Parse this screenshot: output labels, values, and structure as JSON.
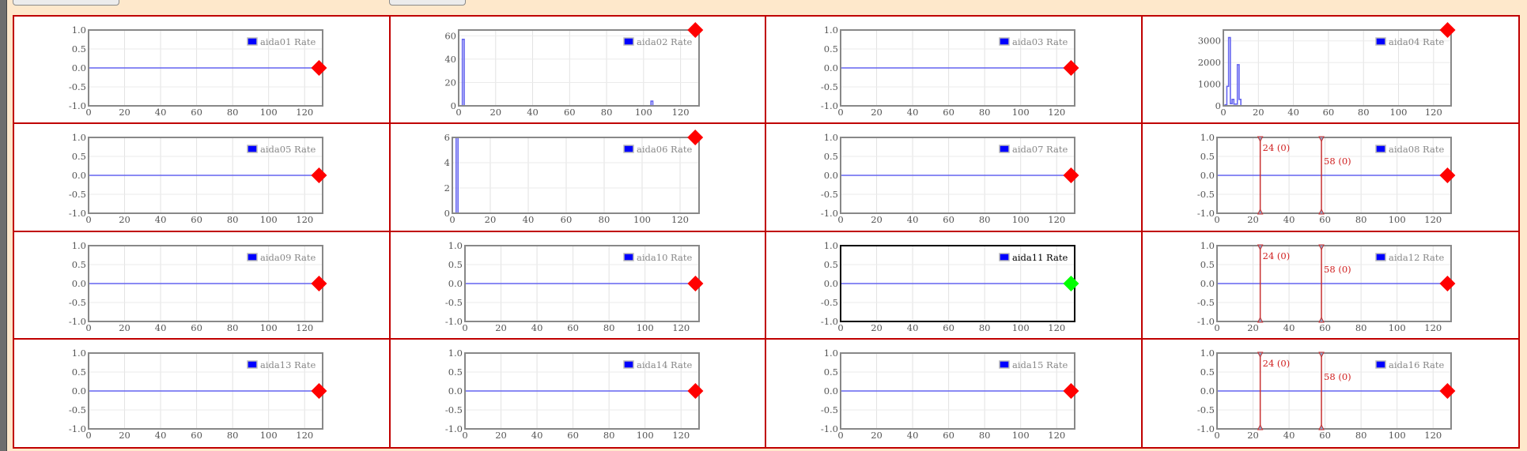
{
  "colors": {
    "accent": "#c00000",
    "series": "#6464f0",
    "marker_alarm": "#ff0000",
    "marker_ok": "#00ff00",
    "cursor": "#d02020"
  },
  "charts": [
    {
      "legend": "aida01 Rate",
      "ylim": [
        -1,
        1
      ],
      "yticks": [
        "1.0",
        "0.5",
        "0.0",
        "-0.5",
        "-1.0"
      ],
      "ytick_values": [
        1,
        0.5,
        0,
        -0.5,
        -1
      ],
      "points": [
        [
          0,
          0
        ],
        [
          128,
          0
        ]
      ],
      "marker": {
        "x": 128,
        "y": 0,
        "color": "#ff0000"
      }
    },
    {
      "legend": "aida02 Rate",
      "ylim": [
        0,
        65
      ],
      "yticks": [
        "60",
        "40",
        "20",
        "0"
      ],
      "ytick_values": [
        60,
        40,
        20,
        0
      ],
      "points": [
        [
          0,
          0
        ],
        [
          2,
          0
        ],
        [
          2,
          57
        ],
        [
          3,
          57
        ],
        [
          3,
          0
        ],
        [
          104,
          0
        ],
        [
          104,
          4
        ],
        [
          105,
          4
        ],
        [
          105,
          0
        ],
        [
          128,
          0
        ]
      ],
      "marker": {
        "x": 128,
        "y": 65,
        "color": "#ff0000"
      }
    },
    {
      "legend": "aida03 Rate",
      "ylim": [
        -1,
        1
      ],
      "yticks": [
        "1.0",
        "0.5",
        "0.0",
        "-0.5",
        "-1.0"
      ],
      "ytick_values": [
        1,
        0.5,
        0,
        -0.5,
        -1
      ],
      "points": [
        [
          0,
          0
        ],
        [
          128,
          0
        ]
      ],
      "marker": {
        "x": 128,
        "y": 0,
        "color": "#ff0000"
      }
    },
    {
      "legend": "aida04 Rate",
      "ylim": [
        0,
        3500
      ],
      "yticks": [
        "3000",
        "2000",
        "1000",
        "0"
      ],
      "ytick_values": [
        3000,
        2000,
        1000,
        0
      ],
      "points": [
        [
          0,
          0
        ],
        [
          1,
          0
        ],
        [
          1,
          50
        ],
        [
          2,
          50
        ],
        [
          2,
          900
        ],
        [
          3,
          900
        ],
        [
          3,
          3150
        ],
        [
          4,
          3150
        ],
        [
          4,
          100
        ],
        [
          5,
          100
        ],
        [
          5,
          300
        ],
        [
          6,
          300
        ],
        [
          6,
          80
        ],
        [
          8,
          80
        ],
        [
          8,
          1900
        ],
        [
          9,
          1900
        ],
        [
          9,
          300
        ],
        [
          10,
          300
        ],
        [
          10,
          0
        ],
        [
          128,
          0
        ]
      ],
      "marker": {
        "x": 128,
        "y": 3500,
        "color": "#ff0000"
      }
    },
    {
      "legend": "aida05 Rate",
      "ylim": [
        -1,
        1
      ],
      "yticks": [
        "1.0",
        "0.5",
        "0.0",
        "-0.5",
        "-1.0"
      ],
      "ytick_values": [
        1,
        0.5,
        0,
        -0.5,
        -1
      ],
      "points": [
        [
          0,
          0
        ],
        [
          128,
          0
        ]
      ],
      "marker": {
        "x": 128,
        "y": 0,
        "color": "#ff0000"
      }
    },
    {
      "legend": "aida06 Rate",
      "ylim": [
        0,
        6
      ],
      "yticks": [
        "6",
        "4",
        "2",
        "0"
      ],
      "ytick_values": [
        6,
        4,
        2,
        0
      ],
      "points": [
        [
          0,
          0
        ],
        [
          2,
          0
        ],
        [
          2,
          6
        ],
        [
          3,
          6
        ],
        [
          3,
          0
        ],
        [
          128,
          0
        ]
      ],
      "marker": {
        "x": 128,
        "y": 6,
        "color": "#ff0000"
      }
    },
    {
      "legend": "aida07 Rate",
      "ylim": [
        -1,
        1
      ],
      "yticks": [
        "1.0",
        "0.5",
        "0.0",
        "-0.5",
        "-1.0"
      ],
      "ytick_values": [
        1,
        0.5,
        0,
        -0.5,
        -1
      ],
      "points": [
        [
          0,
          0
        ],
        [
          128,
          0
        ]
      ],
      "marker": {
        "x": 128,
        "y": 0,
        "color": "#ff0000"
      }
    },
    {
      "legend": "aida08 Rate",
      "ylim": [
        -1,
        1
      ],
      "yticks": [
        "1.0",
        "0.5",
        "0.0",
        "-0.5",
        "-1.0"
      ],
      "ytick_values": [
        1,
        0.5,
        0,
        -0.5,
        -1
      ],
      "points": [
        [
          0,
          0
        ],
        [
          128,
          0
        ]
      ],
      "marker": {
        "x": 128,
        "y": 0,
        "color": "#ff0000"
      },
      "cursors": [
        {
          "x": 24,
          "label": "24 (0)"
        },
        {
          "x": 58,
          "label": "58 (0)"
        }
      ]
    },
    {
      "legend": "aida09 Rate",
      "ylim": [
        -1,
        1
      ],
      "yticks": [
        "1.0",
        "0.5",
        "0.0",
        "-0.5",
        "-1.0"
      ],
      "ytick_values": [
        1,
        0.5,
        0,
        -0.5,
        -1
      ],
      "points": [
        [
          0,
          0
        ],
        [
          128,
          0
        ]
      ],
      "marker": {
        "x": 128,
        "y": 0,
        "color": "#ff0000"
      }
    },
    {
      "legend": "aida10 Rate",
      "ylim": [
        -1,
        1
      ],
      "yticks": [
        "1.0",
        "0.5",
        "0.0",
        "-0.5",
        "-1.0"
      ],
      "ytick_values": [
        1,
        0.5,
        0,
        -0.5,
        -1
      ],
      "points": [
        [
          0,
          0
        ],
        [
          128,
          0
        ]
      ],
      "marker": {
        "x": 128,
        "y": 0,
        "color": "#ff0000"
      }
    },
    {
      "legend": "aida11 Rate",
      "ylim": [
        -1,
        1
      ],
      "yticks": [
        "1.0",
        "0.5",
        "0.0",
        "-0.5",
        "-1.0"
      ],
      "ytick_values": [
        1,
        0.5,
        0,
        -0.5,
        -1
      ],
      "points": [
        [
          0,
          0
        ],
        [
          128,
          0
        ]
      ],
      "marker": {
        "x": 128,
        "y": 0,
        "color": "#00ff00"
      },
      "selected": true
    },
    {
      "legend": "aida12 Rate",
      "ylim": [
        -1,
        1
      ],
      "yticks": [
        "1.0",
        "0.5",
        "0.0",
        "-0.5",
        "-1.0"
      ],
      "ytick_values": [
        1,
        0.5,
        0,
        -0.5,
        -1
      ],
      "points": [
        [
          0,
          0
        ],
        [
          128,
          0
        ]
      ],
      "marker": {
        "x": 128,
        "y": 0,
        "color": "#ff0000"
      },
      "cursors": [
        {
          "x": 24,
          "label": "24 (0)"
        },
        {
          "x": 58,
          "label": "58 (0)"
        }
      ]
    },
    {
      "legend": "aida13 Rate",
      "ylim": [
        -1,
        1
      ],
      "yticks": [
        "1.0",
        "0.5",
        "0.0",
        "-0.5",
        "-1.0"
      ],
      "ytick_values": [
        1,
        0.5,
        0,
        -0.5,
        -1
      ],
      "points": [
        [
          0,
          0
        ],
        [
          128,
          0
        ]
      ],
      "marker": {
        "x": 128,
        "y": 0,
        "color": "#ff0000"
      }
    },
    {
      "legend": "aida14 Rate",
      "ylim": [
        -1,
        1
      ],
      "yticks": [
        "1.0",
        "0.5",
        "0.0",
        "-0.5",
        "-1.0"
      ],
      "ytick_values": [
        1,
        0.5,
        0,
        -0.5,
        -1
      ],
      "points": [
        [
          0,
          0
        ],
        [
          128,
          0
        ]
      ],
      "marker": {
        "x": 128,
        "y": 0,
        "color": "#ff0000"
      }
    },
    {
      "legend": "aida15 Rate",
      "ylim": [
        -1,
        1
      ],
      "yticks": [
        "1.0",
        "0.5",
        "0.0",
        "-0.5",
        "-1.0"
      ],
      "ytick_values": [
        1,
        0.5,
        0,
        -0.5,
        -1
      ],
      "points": [
        [
          0,
          0
        ],
        [
          128,
          0
        ]
      ],
      "marker": {
        "x": 128,
        "y": 0,
        "color": "#ff0000"
      }
    },
    {
      "legend": "aida16 Rate",
      "ylim": [
        -1,
        1
      ],
      "yticks": [
        "1.0",
        "0.5",
        "0.0",
        "-0.5",
        "-1.0"
      ],
      "ytick_values": [
        1,
        0.5,
        0,
        -0.5,
        -1
      ],
      "points": [
        [
          0,
          0
        ],
        [
          128,
          0
        ]
      ],
      "marker": {
        "x": 128,
        "y": 0,
        "color": "#ff0000"
      },
      "cursors": [
        {
          "x": 24,
          "label": "24 (0)"
        },
        {
          "x": 58,
          "label": "58 (0)"
        }
      ]
    }
  ],
  "xaxis": {
    "ticks": [
      "0",
      "20",
      "40",
      "60",
      "80",
      "100",
      "120"
    ],
    "tick_values": [
      0,
      20,
      40,
      60,
      80,
      100,
      120
    ],
    "xlim": [
      0,
      130
    ]
  }
}
